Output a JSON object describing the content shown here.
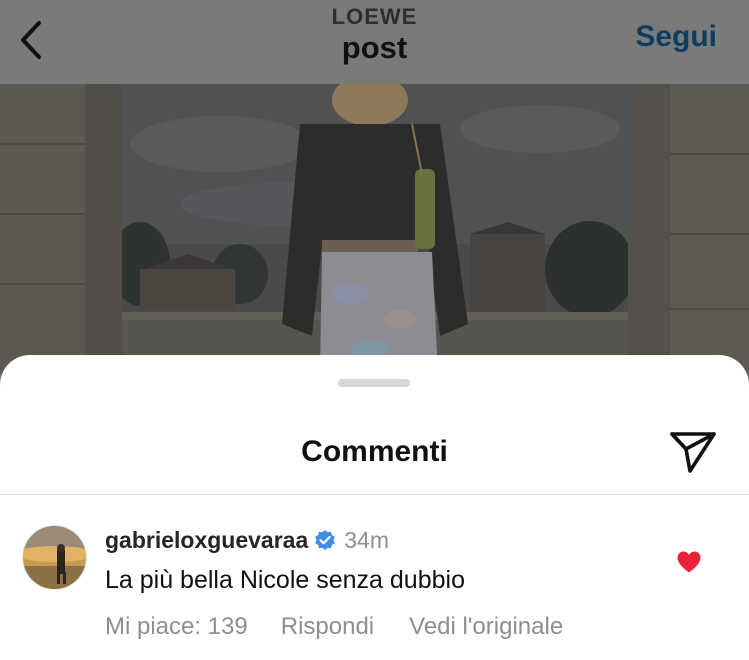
{
  "header": {
    "overline": "LOEWE",
    "title": "post",
    "follow_label": "Segui",
    "back_icon": "chevron-left-icon"
  },
  "photo": {
    "description_icon": "post-photo"
  },
  "sheet": {
    "title": "Commenti",
    "share_icon": "paper-plane-icon"
  },
  "comment": {
    "username": "gabrieloxguevaraa",
    "verified": true,
    "timestamp": "34m",
    "text": "La più bella Nicole senza dubbio",
    "likes_label": "Mi piace: 139",
    "reply_label": "Rispondi",
    "see_original_label": "Vedi l'originale",
    "liked": true,
    "like_icon": "heart-icon"
  },
  "colors": {
    "follow": "#0b3e61",
    "verified": "#3a8ee6",
    "heart": "#e8223a",
    "muted_text": "#8e8e8e"
  }
}
